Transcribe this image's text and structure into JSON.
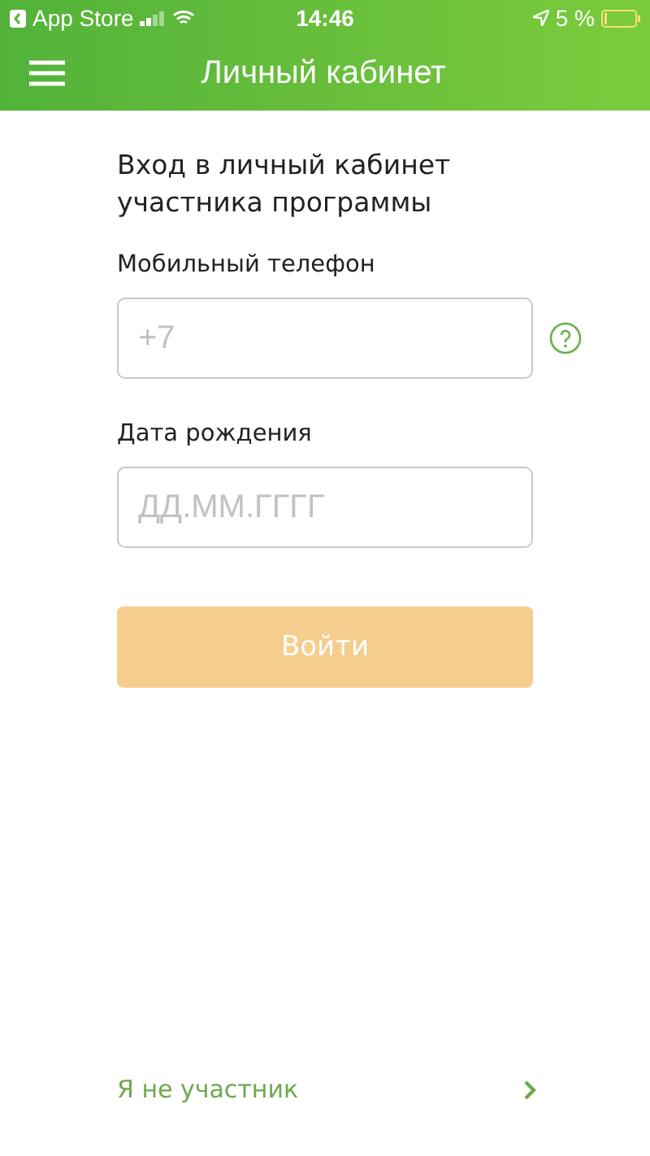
{
  "status_bar": {
    "back_app": "App Store",
    "time": "14:46",
    "battery": "5 %"
  },
  "header": {
    "title": "Личный кабинет"
  },
  "form": {
    "heading": "Вход в личный кабинет участника программы",
    "fields": [
      {
        "label": "Мобильный телефон",
        "placeholder": "+7",
        "kind": "with_help"
      },
      {
        "label": "Дата рождения",
        "placeholder": "ДД.ММ.ГГГГ",
        "kind": "plain"
      }
    ],
    "submit": {
      "label": "Войти",
      "disabled": true
    }
  },
  "footer_link": {
    "label": "Я не участник"
  }
}
